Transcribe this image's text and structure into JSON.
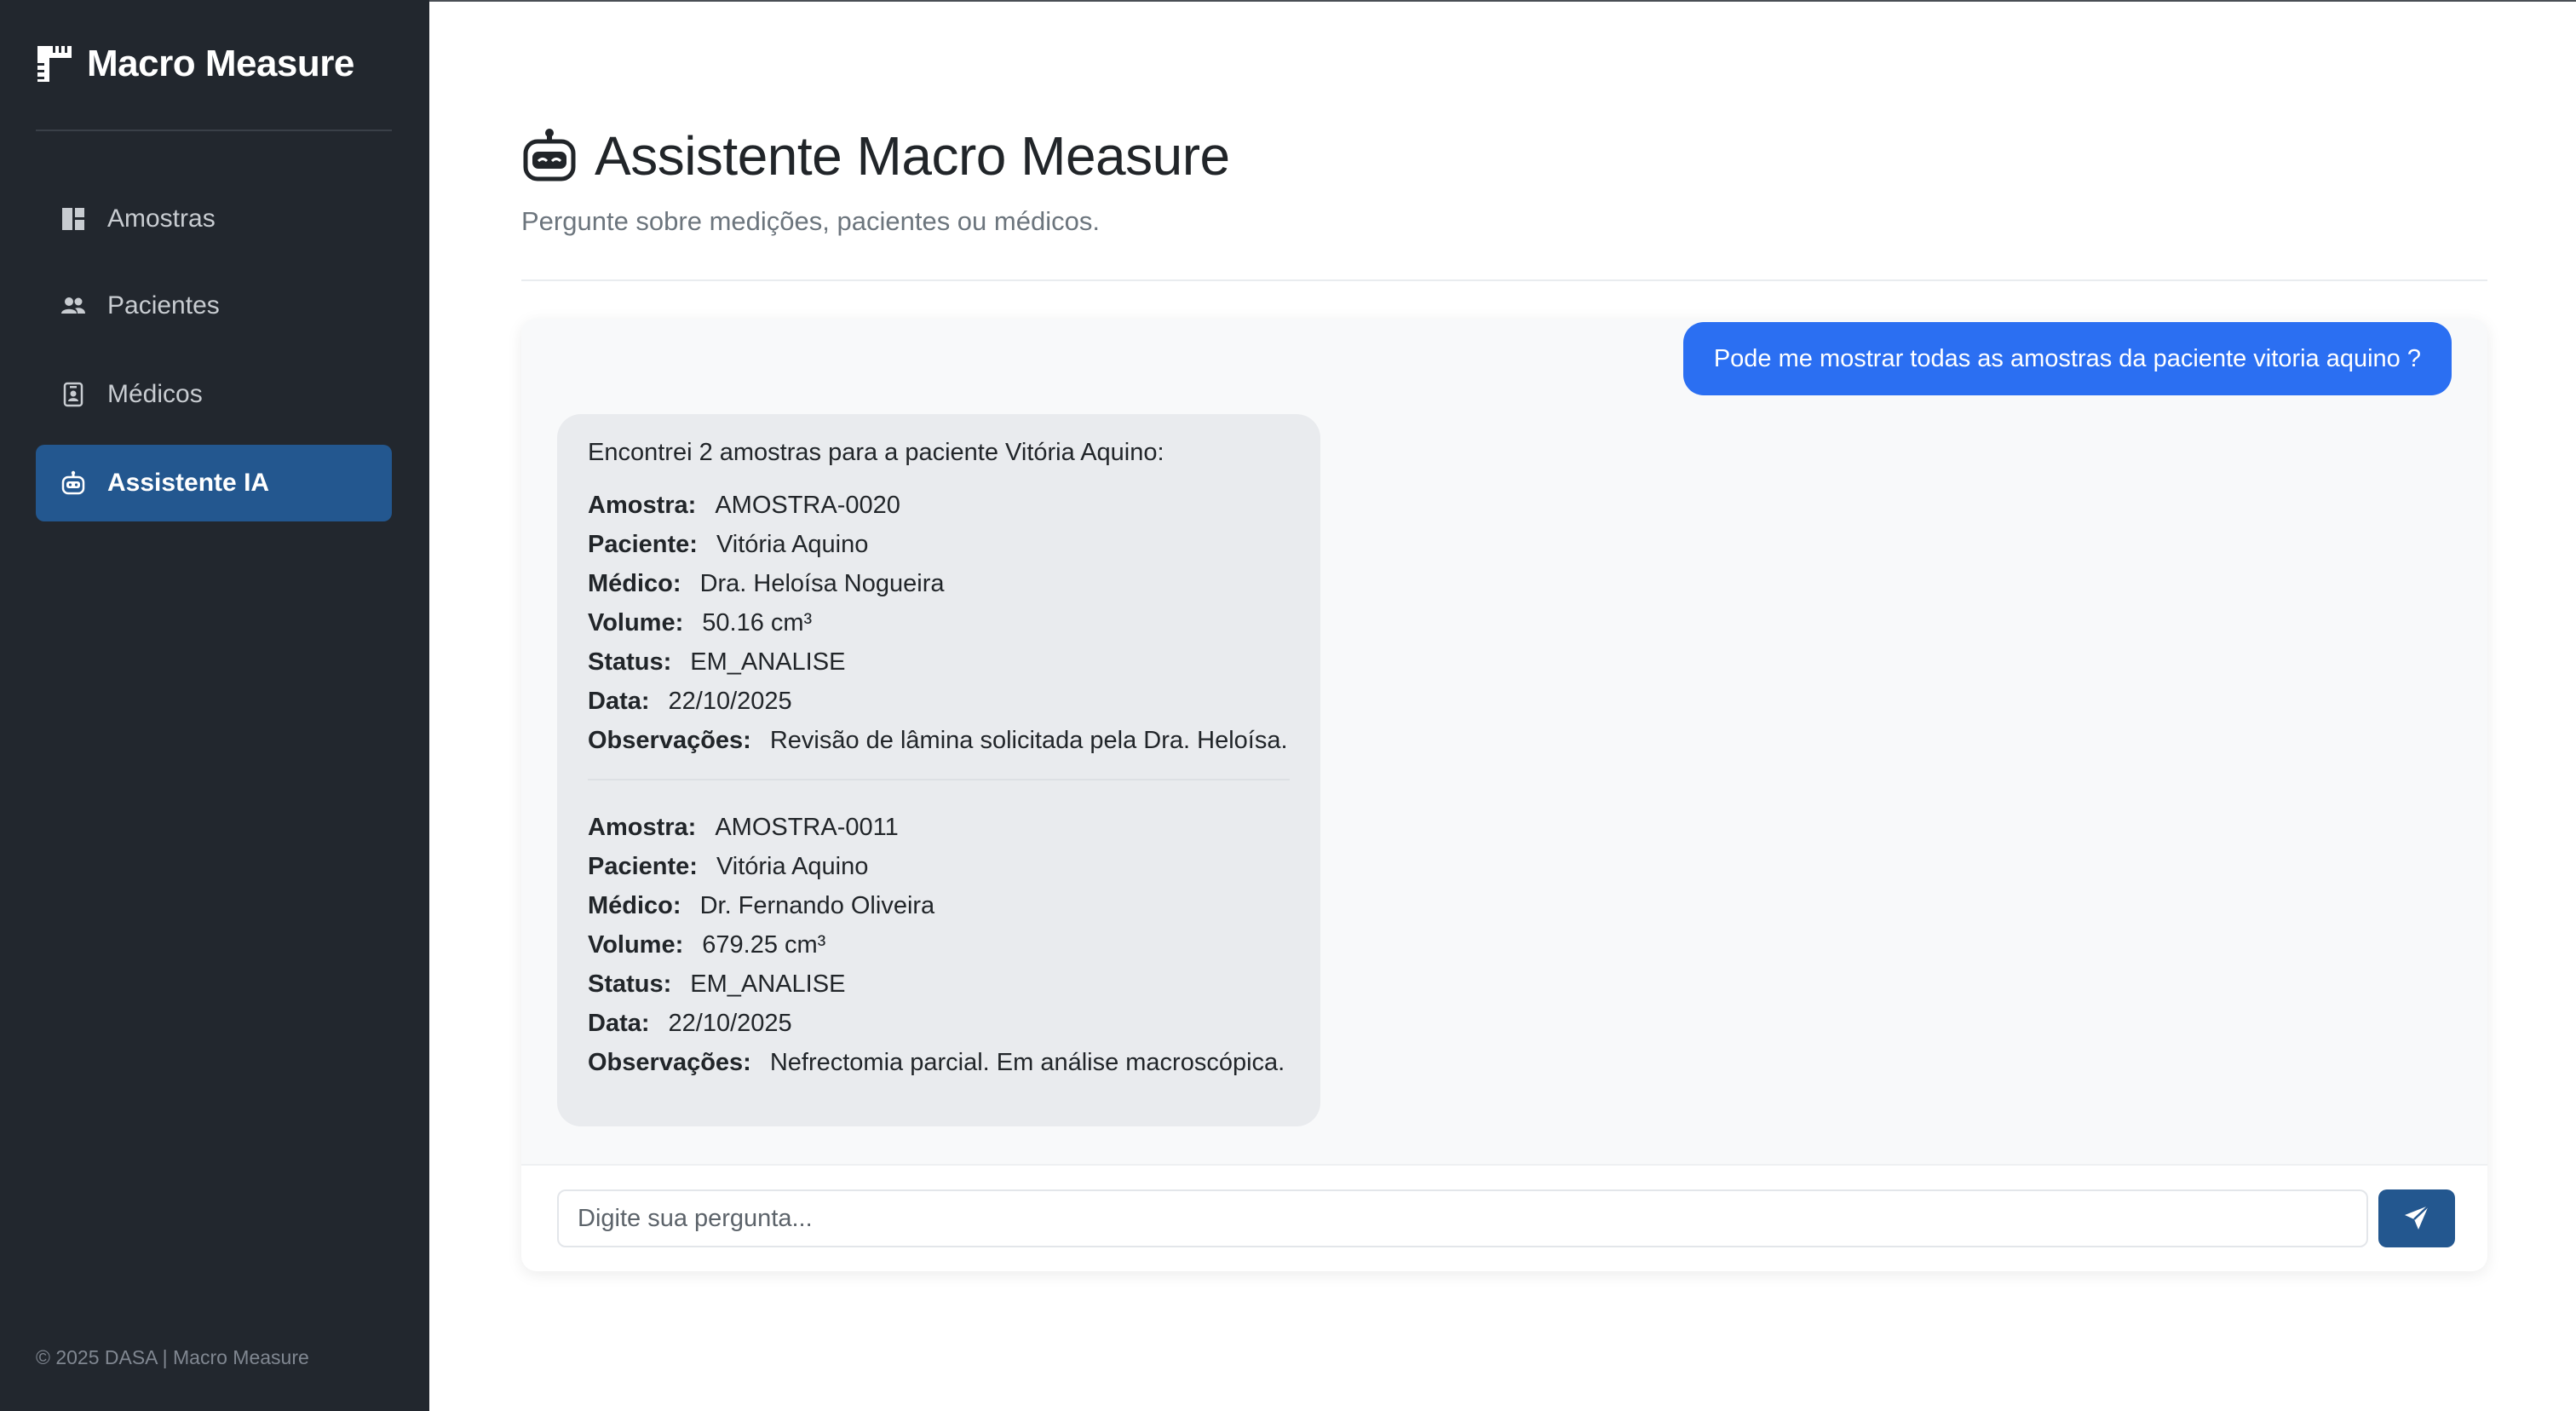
{
  "brand": {
    "name": "Macro Measure",
    "icon": "ruler-icon"
  },
  "sidebar": {
    "items": [
      {
        "label": "Amostras",
        "icon": "dashboard-icon",
        "active": false
      },
      {
        "label": "Pacientes",
        "icon": "people-icon",
        "active": false
      },
      {
        "label": "Médicos",
        "icon": "badge-icon",
        "active": false
      },
      {
        "label": "Assistente IA",
        "icon": "robot-icon",
        "active": true
      }
    ],
    "footer": "© 2025 DASA | Macro Measure"
  },
  "page": {
    "title": "Assistente Macro Measure",
    "title_icon": "robot-icon",
    "subtitle": "Pergunte sobre medições, pacientes ou médicos."
  },
  "chat": {
    "user_message": "Pode me mostrar todas as amostras da paciente vitoria aquino ?",
    "bot_intro": "Encontrei 2 amostras para a paciente Vitória Aquino:",
    "labels": {
      "amostra": "Amostra:",
      "paciente": "Paciente:",
      "medico": "Médico:",
      "volume": "Volume:",
      "status": "Status:",
      "data": "Data:",
      "observacoes": "Observações:"
    },
    "samples": [
      {
        "amostra": "AMOSTRA-0020",
        "paciente": "Vitória Aquino",
        "medico": "Dra. Heloísa Nogueira",
        "volume": "50.16 cm³",
        "status": "EM_ANALISE",
        "data": "22/10/2025",
        "observacoes": "Revisão de lâmina solicitada pela Dra. Heloísa."
      },
      {
        "amostra": "AMOSTRA-0011",
        "paciente": "Vitória Aquino",
        "medico": "Dr. Fernando Oliveira",
        "volume": "679.25 cm³",
        "status": "EM_ANALISE",
        "data": "22/10/2025",
        "observacoes": "Nefrectomia parcial. Em análise macroscópica."
      }
    ],
    "input_placeholder": "Digite sua pergunta...",
    "send_icon": "send-icon"
  },
  "colors": {
    "sidebar_bg": "#22272e",
    "active_nav": "#23578f",
    "user_bubble": "#2b6ff2",
    "bot_bubble": "#e9ebee"
  }
}
